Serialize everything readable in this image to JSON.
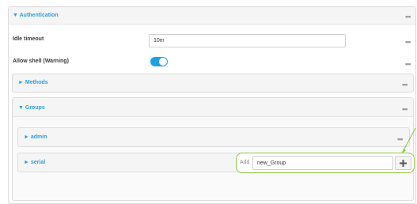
{
  "authentication": {
    "header": "▼ Authentication",
    "idle_timeout": {
      "label": "Idle timeout",
      "value": "10m"
    },
    "allow_shell": {
      "label": "Allow shell (Warning)",
      "enabled": true
    },
    "methods": {
      "header": "► Methods"
    },
    "groups": {
      "header": "▼ Groups",
      "items": [
        {
          "label": "► admin"
        },
        {
          "label": "► serial"
        }
      ],
      "add": {
        "label": "Add",
        "value": "new_Group",
        "button": "+"
      }
    }
  },
  "colors": {
    "accent": "#2f9fd8",
    "toggle_on": "#1fa3e0",
    "callout": "#8cc63f"
  },
  "icons": {
    "menu": "ellipsis-icon",
    "add": "plus-icon"
  }
}
